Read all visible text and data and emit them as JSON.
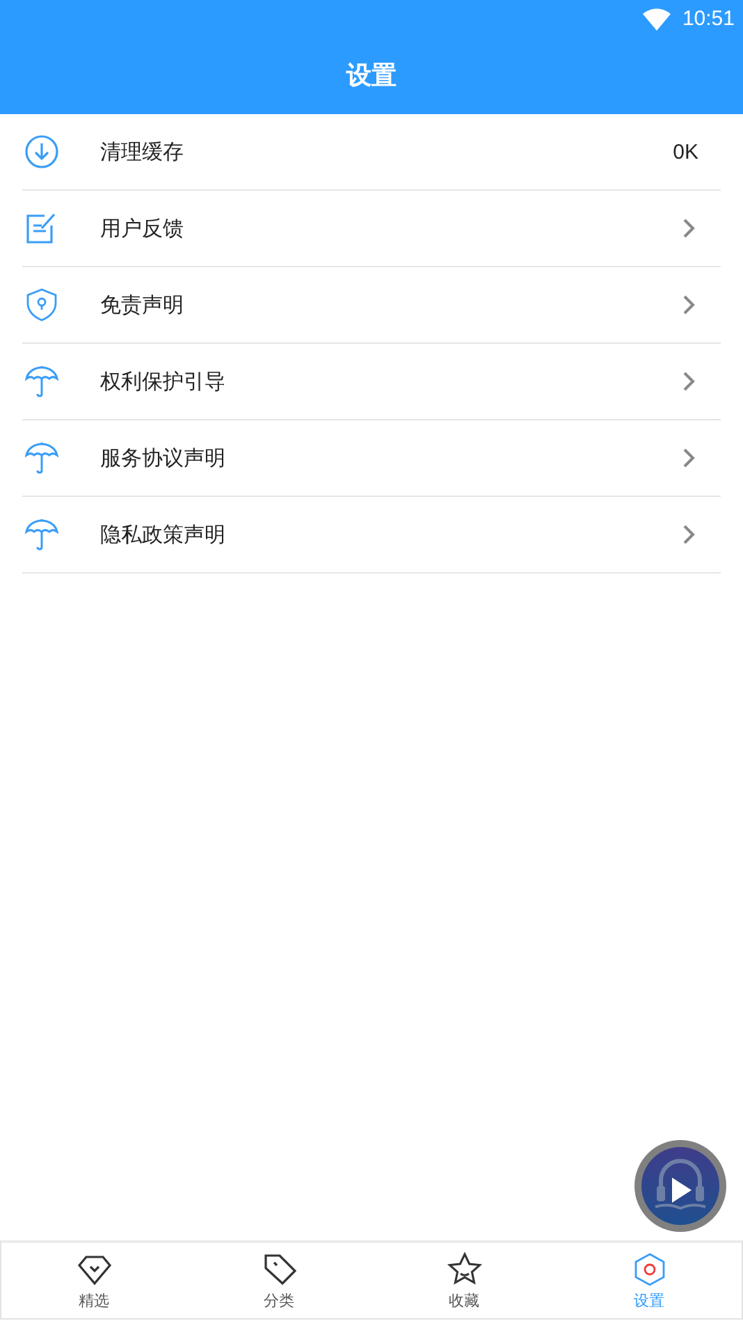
{
  "status_bar": {
    "time": "10:51"
  },
  "header": {
    "title": "设置"
  },
  "settings": [
    {
      "label": "清理缓存",
      "kind": "value",
      "value": "0K"
    },
    {
      "label": "用户反馈",
      "kind": "link"
    },
    {
      "label": "免责声明",
      "kind": "link"
    },
    {
      "label": "权利保护引导",
      "kind": "link"
    },
    {
      "label": "服务协议声明",
      "kind": "link"
    },
    {
      "label": "隐私政策声明",
      "kind": "link"
    }
  ],
  "tabs": [
    {
      "label": "精选",
      "selected": false
    },
    {
      "label": "分类",
      "selected": false
    },
    {
      "label": "收藏",
      "selected": false
    },
    {
      "label": "设置",
      "selected": true
    }
  ]
}
